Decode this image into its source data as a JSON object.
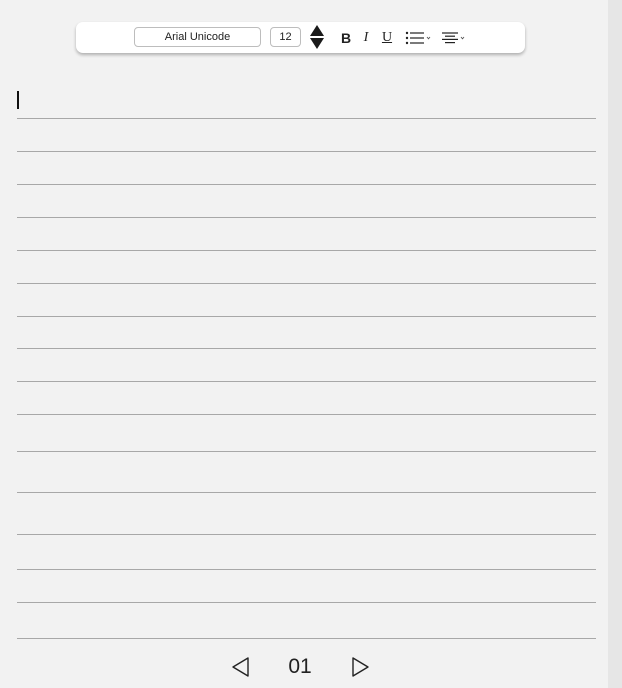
{
  "toolbar": {
    "font_name": "Arial Unicode",
    "font_size": "12",
    "bold_label": "B",
    "italic_label": "I",
    "underline_label": "U",
    "increase_icon": "triangle-up-icon",
    "decrease_icon": "triangle-down-icon",
    "list_icon": "bulleted-list-icon",
    "align_icon": "align-center-icon"
  },
  "page": {
    "ruled_line_count": 16,
    "number": "01",
    "prev_icon": "triangle-left-icon",
    "next_icon": "triangle-right-icon"
  },
  "colors": {
    "background": "#f2f2f2",
    "toolbar": "#ffffff",
    "rule": "#a8a8a8",
    "text": "#222222"
  }
}
